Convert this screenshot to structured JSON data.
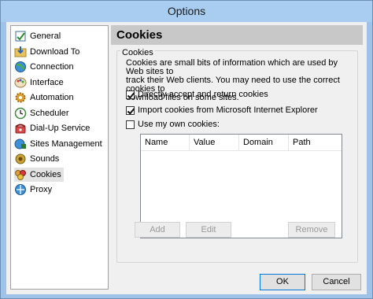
{
  "window": {
    "title": "Options"
  },
  "sidebar": {
    "items": [
      {
        "label": "General",
        "icon": "general-icon",
        "selected": false
      },
      {
        "label": "Download To",
        "icon": "download-folder-icon",
        "selected": false
      },
      {
        "label": "Connection",
        "icon": "globe-icon",
        "selected": false
      },
      {
        "label": "Interface",
        "icon": "palette-icon",
        "selected": false
      },
      {
        "label": "Automation",
        "icon": "gear-icon",
        "selected": false
      },
      {
        "label": "Scheduler",
        "icon": "clock-icon",
        "selected": false
      },
      {
        "label": "Dial-Up Service",
        "icon": "phone-icon",
        "selected": false
      },
      {
        "label": "Sites Management",
        "icon": "sites-icon",
        "selected": false
      },
      {
        "label": "Sounds",
        "icon": "speaker-icon",
        "selected": false
      },
      {
        "label": "Cookies",
        "icon": "cookie-icon",
        "selected": true
      },
      {
        "label": "Proxy",
        "icon": "proxy-icon",
        "selected": false
      }
    ]
  },
  "panel": {
    "header": "Cookies",
    "group_title": "Cookies",
    "description_lines": [
      "Cookies are small bits of information which are used by Web sites to",
      "track their Web clients. You may need to use the correct cookies to",
      "download files on some sites."
    ],
    "options": [
      {
        "label": "Directly accept and return cookies",
        "checked": true
      },
      {
        "label": "Import cookies from Microsoft Internet Explorer",
        "checked": true
      },
      {
        "label": "Use my own cookies:",
        "checked": false
      }
    ],
    "table": {
      "columns": [
        "Name",
        "Value",
        "Domain",
        "Path"
      ],
      "rows": []
    },
    "buttons": {
      "add": "Add",
      "edit": "Edit",
      "remove": "Remove"
    }
  },
  "footer": {
    "ok": "OK",
    "cancel": "Cancel"
  }
}
